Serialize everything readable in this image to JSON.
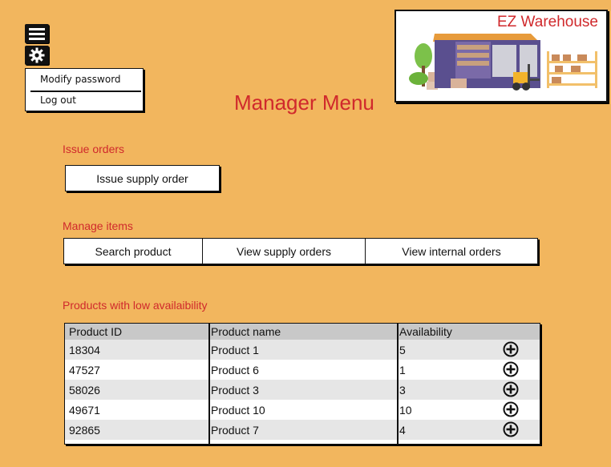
{
  "brand": {
    "name": "EZ Warehouse"
  },
  "user_menu": {
    "items": [
      {
        "label": "Modify password"
      },
      {
        "label": "Log out"
      }
    ]
  },
  "page": {
    "title": "Manager Menu"
  },
  "issue_orders": {
    "heading": "Issue orders",
    "button_label": "Issue supply order"
  },
  "manage_items": {
    "heading": "Manage items",
    "buttons": [
      {
        "label": "Search product"
      },
      {
        "label": "View supply orders"
      },
      {
        "label": "View internal orders"
      }
    ]
  },
  "low_availability": {
    "heading": "Products with low availaibility",
    "columns": [
      "Product ID",
      "Product name",
      "Availability"
    ],
    "rows": [
      {
        "id": "18304",
        "name": "Product 1",
        "availability": "5"
      },
      {
        "id": "47527",
        "name": "Product 6",
        "availability": "1"
      },
      {
        "id": "58026",
        "name": "Product 3",
        "availability": "3"
      },
      {
        "id": "49671",
        "name": "Product 10",
        "availability": "10"
      },
      {
        "id": "92865",
        "name": "Product 7",
        "availability": "4"
      }
    ]
  },
  "colors": {
    "background": "#f2b65e",
    "accent": "#d0292c",
    "row_alt": "#e6e6e6",
    "header_bg": "#c8c8c8"
  }
}
